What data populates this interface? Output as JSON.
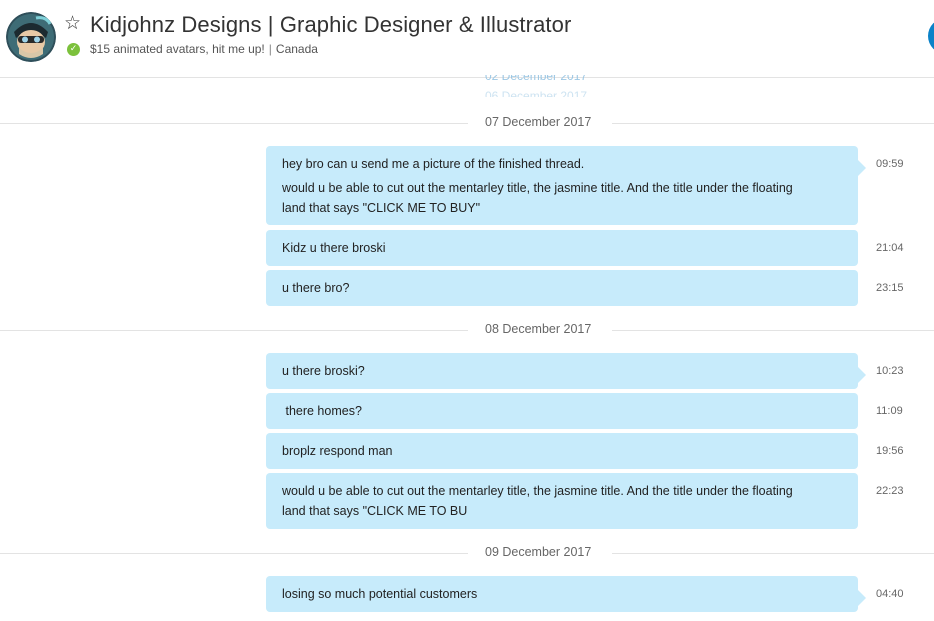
{
  "header": {
    "title": "Kidjohnz Designs | Graphic Designer & Illustrator",
    "mood": "$15 animated avatars, hit me up!",
    "location": "Canada",
    "separator": "|",
    "status": "online",
    "star_icon": "star-outline-icon",
    "status_icon": "check-circle-icon",
    "call_icon": "call-button"
  },
  "faded_dates": [
    "02 December 2017",
    "06 December 2017"
  ],
  "days": [
    {
      "date": "07 December 2017",
      "messages": [
        {
          "lines": [
            "hey bro can u send me a picture of the finished thread.",
            "would u be able to cut out the mentarley title, the jasmine title. And the title under the floating land that says \"CLICK ME TO BUY\""
          ],
          "time": "09:59"
        },
        {
          "lines": [
            "Kidz u there broski"
          ],
          "time": "21:04"
        },
        {
          "lines": [
            "u there bro?"
          ],
          "time": "23:15"
        }
      ]
    },
    {
      "date": "08 December 2017",
      "messages": [
        {
          "lines": [
            "u there broski?"
          ],
          "time": "10:23"
        },
        {
          "lines": [
            " there homes?"
          ],
          "time": "11:09"
        },
        {
          "lines": [
            "broplz respond man"
          ],
          "time": "19:56"
        },
        {
          "lines": [
            "would u be able to cut out the mentarley title, the jasmine title. And the title under the floating land that says \"CLICK ME TO BU"
          ],
          "time": "22:23"
        }
      ]
    },
    {
      "date": "09 December 2017",
      "messages": [
        {
          "lines": [
            "losing so much potential customers"
          ],
          "time": "04:40"
        }
      ]
    }
  ],
  "colors": {
    "bubble": "#c7ebfb",
    "status_online": "#7cc13c",
    "accent": "#0b82c8",
    "divider": "#e3e3e3"
  }
}
